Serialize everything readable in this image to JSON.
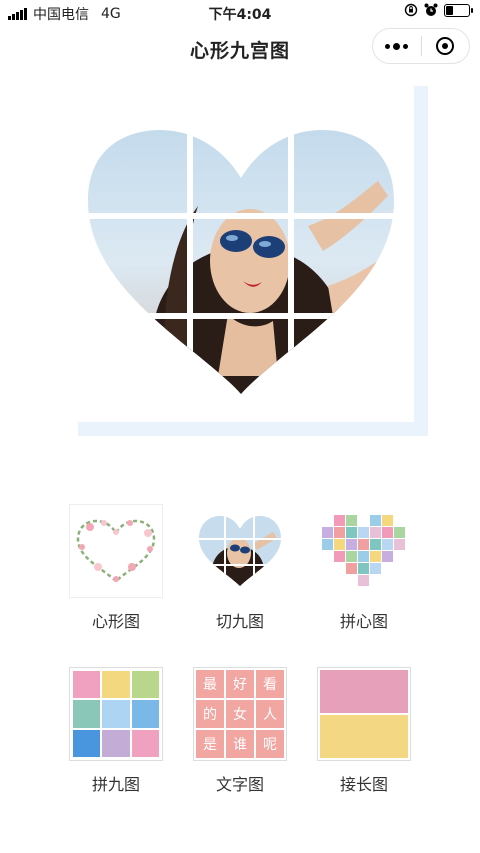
{
  "status_bar": {
    "carrier": "中国电信",
    "network": "4G",
    "time": "下午4:04",
    "battery_level": 0.35
  },
  "nav": {
    "title": "心形九宫图"
  },
  "menu": {
    "row1": [
      {
        "label": "心形图",
        "icon": "floral-heart-thumbnail"
      },
      {
        "label": "切九图",
        "icon": "photo-heart-thumbnail"
      },
      {
        "label": "拼心图",
        "icon": "pixel-heart-thumbnail"
      }
    ],
    "row2": [
      {
        "label": "拼九图",
        "icon": "color-grid-thumbnail"
      },
      {
        "label": "文字图",
        "icon": "text-grid-thumbnail"
      },
      {
        "label": "接长图",
        "icon": "long-image-thumbnail"
      }
    ]
  },
  "text_grid_chars": [
    "最",
    "好",
    "看",
    "的",
    "女",
    "人",
    "是",
    "谁",
    "呢"
  ],
  "colors": {
    "frame": "#eaf3fb",
    "text_grid_bg": "#f1a6a2",
    "nine_grid": [
      "#f0a1c0",
      "#f4d880",
      "#b8d68c",
      "#8ac7b8",
      "#add4f2",
      "#7ab8e8",
      "#4a96de",
      "#c3acd6",
      "#f0a1c0"
    ],
    "long_image": [
      "#e6a0b9",
      "#f3d782"
    ]
  }
}
